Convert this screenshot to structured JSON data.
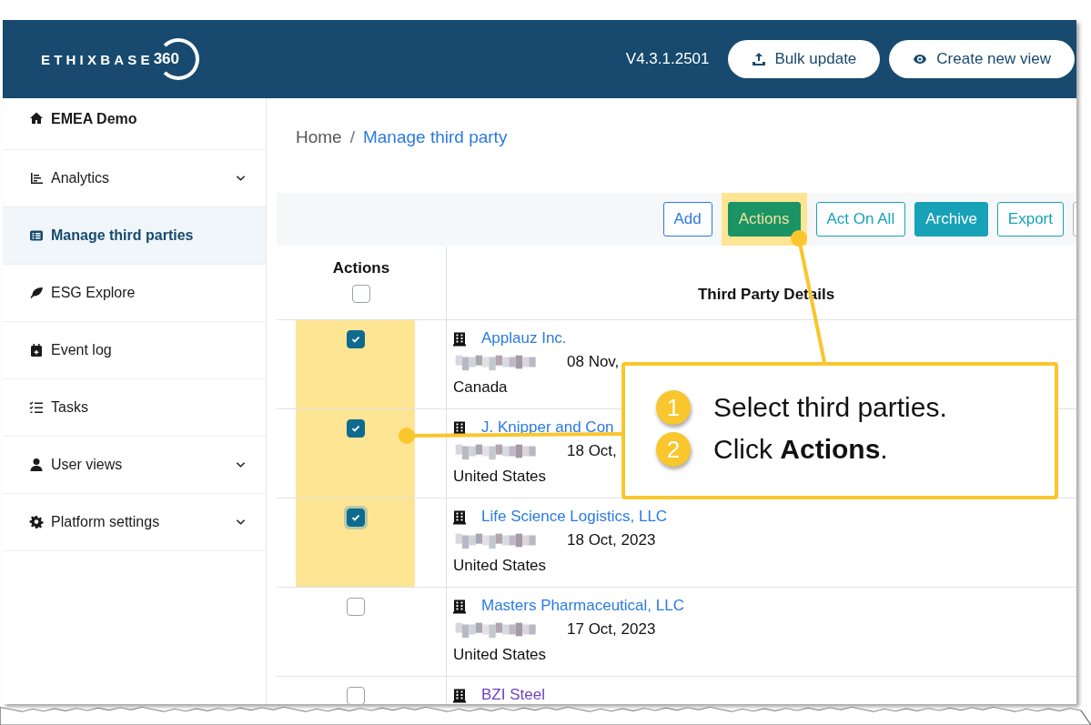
{
  "header": {
    "logo": {
      "word": "ETHIXBASE",
      "number": "360"
    },
    "version": "V4.3.1.2501",
    "buttons": [
      {
        "label": "Bulk update"
      },
      {
        "label": "Create new view"
      }
    ]
  },
  "sidebar": {
    "items": [
      {
        "label": "EMEA Demo",
        "kind": "home",
        "selected": false
      },
      {
        "label": "Analytics",
        "kind": "group",
        "selected": false
      },
      {
        "label": "Manage third parties",
        "kind": "item",
        "selected": true
      },
      {
        "label": "ESG Explore",
        "kind": "item",
        "selected": false
      },
      {
        "label": "Event log",
        "kind": "item",
        "selected": false
      },
      {
        "label": "Tasks",
        "kind": "item",
        "selected": false
      },
      {
        "label": "User views",
        "kind": "group",
        "selected": false
      },
      {
        "label": "Platform settings",
        "kind": "group",
        "selected": false
      }
    ]
  },
  "breadcrumb": {
    "separator": "/",
    "items": [
      {
        "label": "Home",
        "current": false
      },
      {
        "label": "Manage third party",
        "current": true
      }
    ]
  },
  "toolbar": {
    "buttons": [
      {
        "label": "Add",
        "kind": "outline-primary",
        "highlighted": false
      },
      {
        "label": "Actions",
        "kind": "success",
        "highlighted": true
      },
      {
        "label": "Act On All",
        "kind": "outline-info",
        "highlighted": false
      },
      {
        "label": "Archive",
        "kind": "info",
        "highlighted": false
      },
      {
        "label": "Export",
        "kind": "outline-info",
        "highlighted": false
      },
      {
        "kind": "outline-secondary",
        "highlighted": false
      }
    ]
  },
  "table": {
    "columns": [
      "Actions",
      "Third Party Details"
    ],
    "select_all": {
      "checked": false
    },
    "rows": [
      {
        "checked": true,
        "highlighted": true,
        "focused": false,
        "name": "Applauz Inc.",
        "visited": false,
        "date": "08 Nov,",
        "country": "Canada"
      },
      {
        "checked": true,
        "highlighted": true,
        "focused": false,
        "name": "J. Knipper and Con",
        "visited": false,
        "date": "18 Oct,",
        "country": "United States"
      },
      {
        "checked": true,
        "highlighted": true,
        "focused": true,
        "name": "Life Science Logistics, LLC",
        "visited": false,
        "date": "18 Oct, 2023",
        "country": "United States"
      },
      {
        "checked": false,
        "highlighted": false,
        "focused": false,
        "name": "Masters Pharmaceutical, LLC",
        "visited": false,
        "date": "17 Oct, 2023",
        "country": "United States"
      },
      {
        "checked": false,
        "highlighted": false,
        "focused": false,
        "name": "BZI Steel",
        "visited": true
      }
    ]
  },
  "callout": {
    "steps": [
      {
        "number": "1",
        "text": "Select third parties."
      },
      {
        "number": "2",
        "text": "Click **Actions**."
      }
    ]
  }
}
